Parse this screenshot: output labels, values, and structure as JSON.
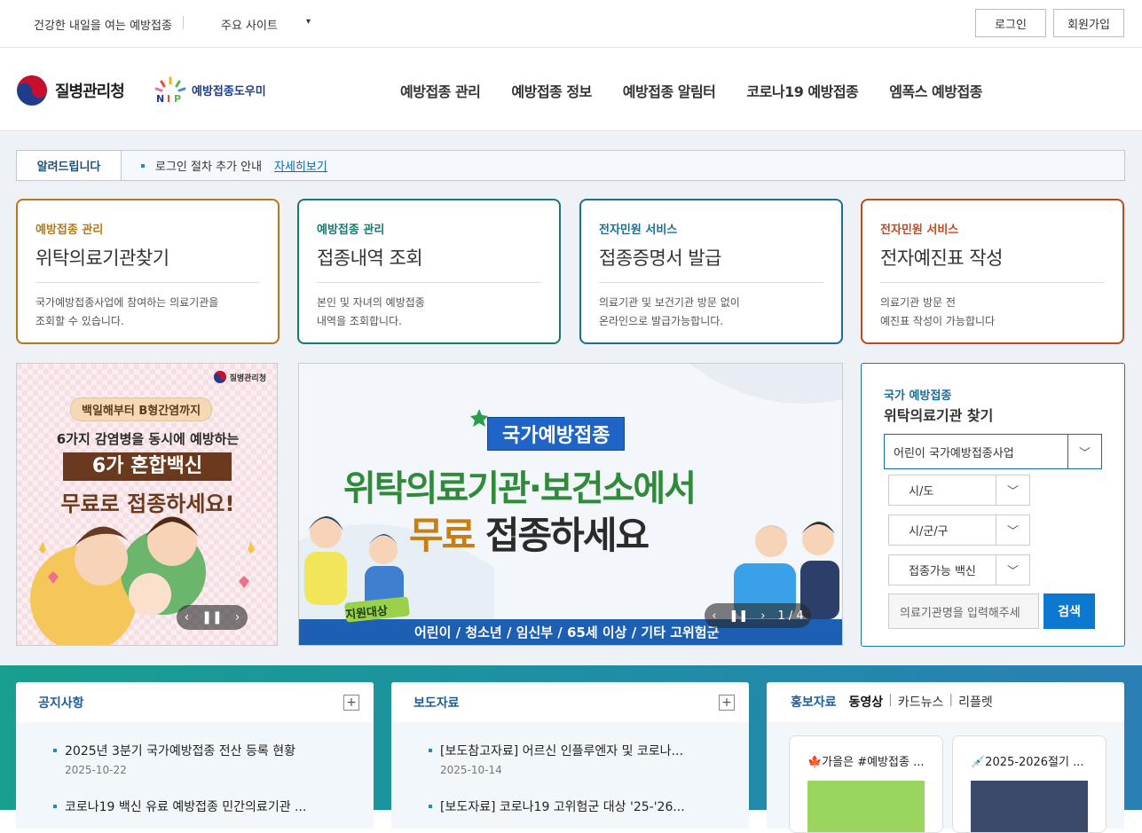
{
  "topbar": {
    "slogan": "건강한 내일을 여는 예방접종",
    "site_select": "주요 사이트",
    "site_arrow": "▾",
    "login": "로그인",
    "join": "회원가입"
  },
  "header": {
    "logo_kdca": "질병관리청",
    "logo_nip": "예방접종도우미",
    "logo_nip_mark": "NIP",
    "nav": [
      "예방접종 관리",
      "예방접종 정보",
      "예방접종 알림터",
      "코로나19 예방접종",
      "엠폭스 예방접종"
    ]
  },
  "notice": {
    "label": "알려드립니다",
    "message": "로그인 절차 추가 안내",
    "more": "자세히보기"
  },
  "cards": [
    {
      "category": "예방접종 관리",
      "title": "위탁의료기관찾기",
      "desc": "국가예방접종사업에 참여하는 의료기관을\n조회할 수 있습니다.",
      "color": "#b27a1a"
    },
    {
      "category": "예방접종 관리",
      "title": "접종내역 조회",
      "desc": "본인 및 자녀의 예방접종\n내역을 조회합니다.",
      "color": "#167a6e"
    },
    {
      "category": "전자민원 서비스",
      "title": "접종증명서 발급",
      "desc": "의료기관 및 보건기관 방문 없이\n온라인으로 발급가능합니다.",
      "color": "#1a6f95"
    },
    {
      "category": "전자민원 서비스",
      "title": "전자예진표 작성",
      "desc": "의료기관 방문 전\n예진표 작성이 가능합니다",
      "color": "#c2481c"
    }
  ],
  "banner_left": {
    "brand": "질병관리청",
    "line1": "백일해부터 B형간염까지",
    "line2": "6가지 감염병을 동시에 예방하는",
    "line3": "6가 혼합백신",
    "line4": "무료로 접종하세요!"
  },
  "banner_main": {
    "badge": "국가예방접종",
    "line1": "위탁의료기관·보건소에서",
    "line2a": "무료",
    "line2b": "접종하세요",
    "tag": "지원대상",
    "targets": "어린이 / 청소년 / 임신부 / 65세 이상 / 기타 고위험군",
    "pager": "1 / 4"
  },
  "finder": {
    "subtitle": "국가 예방접종",
    "title": "위탁의료기관 찾기",
    "program": "어린이 국가예방접종사업",
    "sido": "시/도",
    "sigungu": "시/군/구",
    "vaccine": "접종가능 백신",
    "search_placeholder": "의료기관명을 입력해주세",
    "search_btn": "검색"
  },
  "panels": {
    "notice_title": "공지사항",
    "notice_items": [
      {
        "title": "2025년 3분기 국가예방접종 전산 등록 현황",
        "date": "2025-10-22"
      },
      {
        "title": "코로나19 백신 유료 예방접종 민간의료기관 ...",
        "date": ""
      }
    ],
    "press_title": "보도자료",
    "press_items": [
      {
        "title": "[보도참고자료] 어르신 인플루엔자 및 코로나...",
        "date": "2025-10-14"
      },
      {
        "title": "[보도자료] 코로나19 고위험군 대상 '25-'26...",
        "date": ""
      }
    ],
    "promo_title": "홍보자료",
    "promo_tabs": [
      "동영상",
      "카드뉴스",
      "리플렛"
    ],
    "promo_cards": [
      "🍁가을은 #예방접종 ...",
      "💉2025-2026절기 ..."
    ]
  },
  "colors": {
    "primary_blue": "#0d78d0",
    "teal": "#189f8e"
  }
}
